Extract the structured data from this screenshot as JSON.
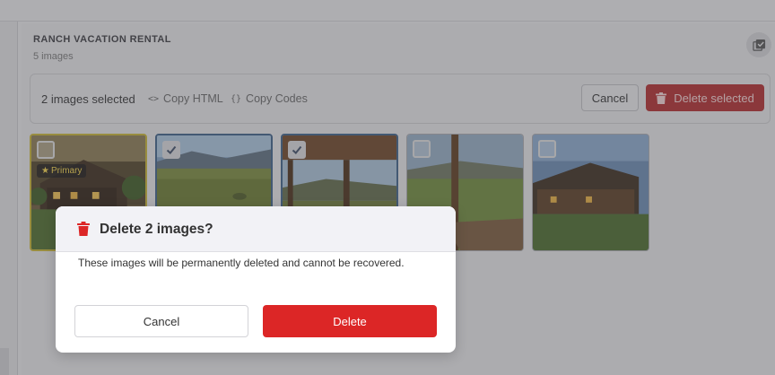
{
  "header": {
    "title": "RANCH VACATION RENTAL",
    "subtitle": "5 images",
    "corner_icon": "select-all-icon"
  },
  "selection_bar": {
    "count_label": "2 images selected",
    "copy_html_label": "Copy HTML",
    "copy_codes_label": "Copy Codes",
    "cancel_label": "Cancel",
    "delete_label": "Delete selected"
  },
  "images": [
    {
      "name": "ranch-house-dusk",
      "checked": false,
      "primary": true
    },
    {
      "name": "mountain-meadow",
      "checked": true,
      "primary": false
    },
    {
      "name": "porch-view",
      "checked": true,
      "primary": false
    },
    {
      "name": "deck-field",
      "checked": false,
      "primary": false
    },
    {
      "name": "ranch-house-evening",
      "checked": false,
      "primary": false
    }
  ],
  "primary_badge_label": "Primary",
  "dialog": {
    "title": "Delete 2 images?",
    "message": "These images will be permanently deleted and cannot be recovered.",
    "cancel_label": "Cancel",
    "delete_label": "Delete"
  },
  "colors": {
    "danger": "#dc2626",
    "primary_border": "#c7b433",
    "selected_border": "#3d5f87"
  }
}
